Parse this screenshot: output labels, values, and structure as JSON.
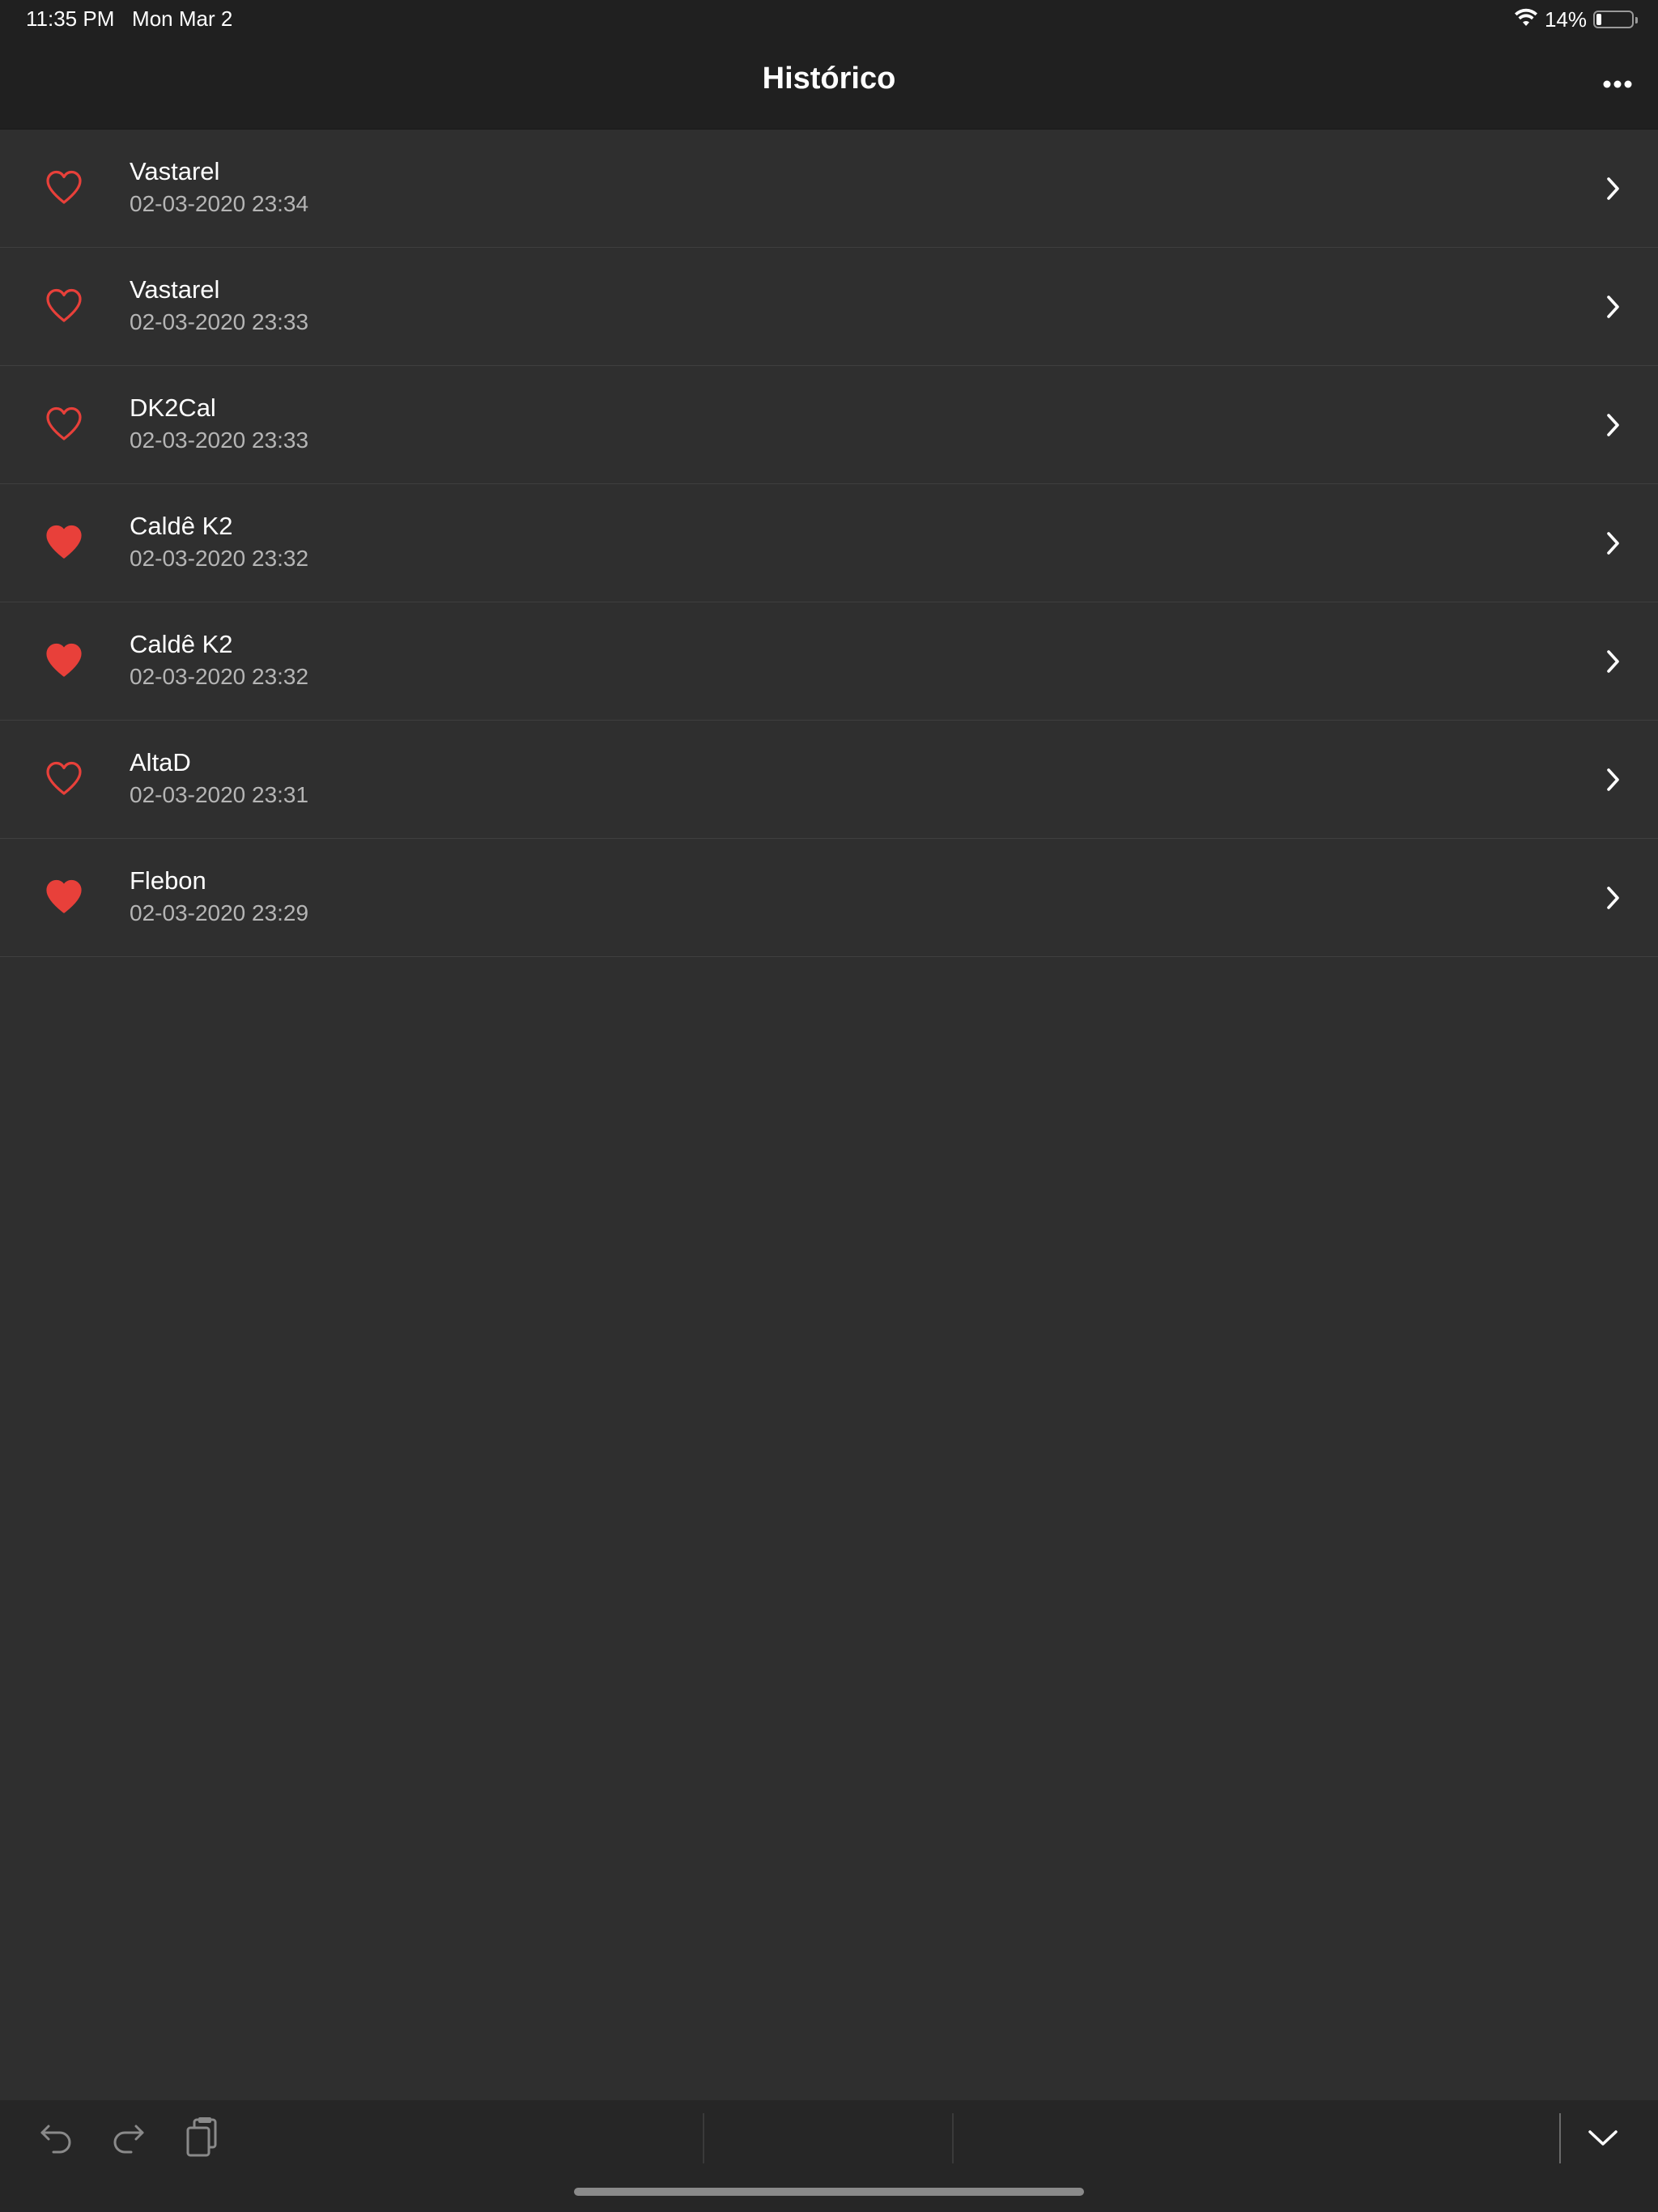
{
  "status_bar": {
    "time": "11:35 PM",
    "date": "Mon Mar 2",
    "battery_percent": "14%",
    "battery_level": 0.14,
    "wifi_icon": "wifi-icon"
  },
  "nav": {
    "title": "Histórico",
    "more_icon": "ellipsis-icon"
  },
  "colors": {
    "heart": "#e8403a",
    "background": "#2f2f2f",
    "bar": "#202020"
  },
  "history": [
    {
      "name": "Vastarel",
      "date": "02-03-2020 23:34",
      "favorite": false
    },
    {
      "name": "Vastarel",
      "date": "02-03-2020 23:33",
      "favorite": false
    },
    {
      "name": "DK2Cal",
      "date": "02-03-2020 23:33",
      "favorite": false
    },
    {
      "name": "Caldê K2",
      "date": "02-03-2020 23:32",
      "favorite": true
    },
    {
      "name": "Caldê K2",
      "date": "02-03-2020 23:32",
      "favorite": true
    },
    {
      "name": "AltaD",
      "date": "02-03-2020 23:31",
      "favorite": false
    },
    {
      "name": "Flebon",
      "date": "02-03-2020 23:29",
      "favorite": true
    }
  ],
  "toolbar": {
    "undo_icon": "undo-icon",
    "redo_icon": "redo-icon",
    "paste_icon": "clipboard-icon",
    "dismiss_icon": "chevron-down-icon"
  }
}
